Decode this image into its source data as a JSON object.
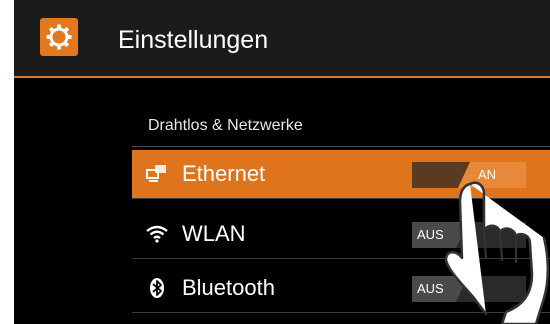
{
  "header": {
    "title": "Einstellungen",
    "icon": "gear-icon",
    "accent_color": "#e4781e"
  },
  "section": {
    "title": "Drahtlos & Netzwerke"
  },
  "rows": [
    {
      "label": "Ethernet",
      "icon": "ethernet-icon",
      "state": "AN",
      "on": true,
      "selected": true
    },
    {
      "label": "WLAN",
      "icon": "wifi-icon",
      "state": "AUS",
      "on": false,
      "selected": false
    },
    {
      "label": "Bluetooth",
      "icon": "bluetooth-icon",
      "state": "AUS",
      "on": false,
      "selected": false
    }
  ],
  "overlay": {
    "icon": "pointing-hand-icon"
  }
}
